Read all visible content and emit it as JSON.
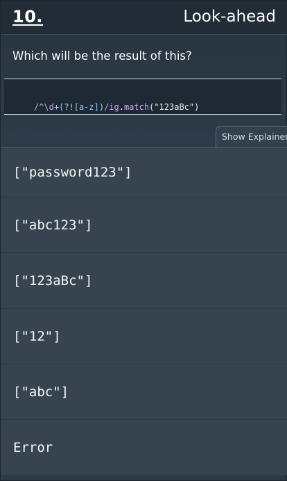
{
  "header": {
    "question_number": "10.",
    "title": "Look-ahead"
  },
  "question": {
    "text": "Which will be the result of this?"
  },
  "code": {
    "tokens": [
      {
        "text": "/^",
        "cls": "c-punct"
      },
      {
        "text": "\\d",
        "cls": "c-esc"
      },
      {
        "text": "+(?!",
        "cls": "c-punct"
      },
      {
        "text": "[a-z]",
        "cls": "c-cls"
      },
      {
        "text": ")/",
        "cls": "c-punct"
      },
      {
        "text": "ig",
        "cls": "c-flag"
      },
      {
        "text": ".",
        "cls": "c-plain"
      },
      {
        "text": "match",
        "cls": "c-fn"
      },
      {
        "text": "(\"123aBc\")",
        "cls": "c-str"
      }
    ]
  },
  "explainer_button": {
    "label": "Show Explainer"
  },
  "options": [
    {
      "label": "[\"password123\"]"
    },
    {
      "label": "[\"abc123\"]"
    },
    {
      "label": "[\"123aBc\"]"
    },
    {
      "label": "[\"12\"]"
    },
    {
      "label": "[\"abc\"]"
    },
    {
      "label": "Error"
    }
  ]
}
